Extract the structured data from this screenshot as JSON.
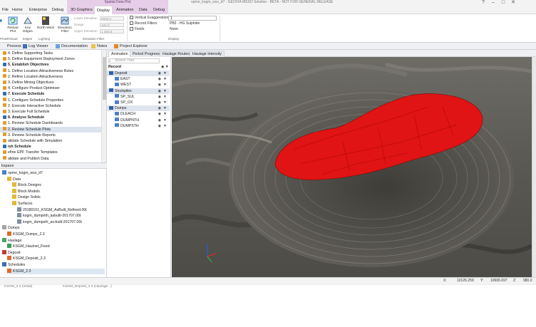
{
  "window": {
    "title": "opme_kogm_wsx_d7 - GEOVIA MSSO Solution - BETA - NOT FOR GENERAL RELEASE",
    "context_group": "Spatial Data Plot"
  },
  "ribbon_tabs": [
    "File",
    "Home",
    "Enterprise",
    "Debug",
    "3D Graphics",
    "Display",
    "Animation",
    "Data",
    "Debug"
  ],
  "ribbon_tab_active": "Display",
  "ribbon": {
    "reload_label": "Reload Plot",
    "key_edges_label": "Key Edges",
    "north_west_label": "North-West",
    "elevation_filter_label": "Elevation Filter",
    "fields": [
      {
        "label": "Lower Elevation",
        "value": "0003.0"
      },
      {
        "label": "Range",
        "value": "100.0"
      },
      {
        "label": "Upper Elevation",
        "value": "1 400.0"
      }
    ],
    "groups": [
      "Plots",
      "Reload",
      "Edges",
      "Lighting",
      "Elevation Filter"
    ],
    "vertical_exaggeration_label": "Vertical Exaggeration",
    "vertical_exaggeration_value": "1",
    "record_filters_label": "Record Filters",
    "record_filters_value": "PB2 - HG Sulphide",
    "fields_label": "Fields",
    "fields_value": "None",
    "display_group": "Display"
  },
  "doc_tabs": [
    "Process",
    "Log Viewer",
    "Documentation",
    "Notes",
    "Project Explorer"
  ],
  "process_items": [
    {
      "text": "4. Define Supporting Tasks",
      "kind": "item"
    },
    {
      "text": "5. Define Equipment Deployment Zones",
      "kind": "item"
    },
    {
      "text": "5. Establish Objectives",
      "kind": "head"
    },
    {
      "text": "1. Define Location Attractiveness Rules",
      "kind": "item"
    },
    {
      "text": "2. Refine Location Attractiveness",
      "kind": "item"
    },
    {
      "text": "3. Define Mining Objectives",
      "kind": "item"
    },
    {
      "text": "4. Configure Product Optimiser",
      "kind": "item"
    },
    {
      "text": "7. Execute Schedule",
      "kind": "head"
    },
    {
      "text": "1. Configure Schedule Properties",
      "kind": "item"
    },
    {
      "text": "2. Execute Interactive Schedule",
      "kind": "item"
    },
    {
      "text": "3. Execute Full Schedule",
      "kind": "item"
    },
    {
      "text": "8. Analyse Schedule",
      "kind": "head"
    },
    {
      "text": "1. Review Schedule Dashboards",
      "kind": "item"
    },
    {
      "text": "2. Review Schedule Plots",
      "kind": "sel"
    },
    {
      "text": "3. Review Schedule Reports",
      "kind": "item"
    },
    {
      "text": "alidate Schedule with Simulation",
      "kind": "item"
    },
    {
      "text": "ish Schedule",
      "kind": "head"
    },
    {
      "text": "efine EPF Transfer Templates",
      "kind": "item"
    },
    {
      "text": "alidate and Publish Data",
      "kind": "item"
    }
  ],
  "workspace": {
    "header": "kspace",
    "items": [
      {
        "text": "opme_kogm_wsx_d7",
        "indent": 0,
        "icon": "project",
        "sel": false
      },
      {
        "text": "Data",
        "indent": 1,
        "icon": "folder",
        "sel": false
      },
      {
        "text": "Block Designs",
        "indent": 2,
        "icon": "folder",
        "sel": false
      },
      {
        "text": "Block Models",
        "indent": 2,
        "icon": "folder",
        "sel": false
      },
      {
        "text": "Design Solids",
        "indent": 2,
        "icon": "folder",
        "sel": false
      },
      {
        "text": "Surfaces",
        "indent": 2,
        "icon": "folder",
        "sel": false
      },
      {
        "text": "20180101_KSGM_AsBuilt_Refined.00t",
        "indent": 3,
        "icon": "surface",
        "sel": false
      },
      {
        "text": "kogm_dumpnth_asbuilt-201707.00t",
        "indent": 3,
        "icon": "surface",
        "sel": false
      },
      {
        "text": "kogm_dumpsth_as-built-201707.00t",
        "indent": 3,
        "icon": "surface",
        "sel": false
      },
      {
        "text": "Dumps",
        "indent": 0,
        "icon": "dump",
        "sel": false
      },
      {
        "text": "KSGM_Dumps_2.3",
        "indent": 1,
        "icon": "edit",
        "sel": false
      },
      {
        "text": "Haulage",
        "indent": 0,
        "icon": "haulage",
        "sel": false
      },
      {
        "text": "KSGM_Haulnet_Fixed",
        "indent": 1,
        "icon": "haulnet",
        "sel": false
      },
      {
        "text": "Deposit",
        "indent": 0,
        "icon": "deposit",
        "sel": false
      },
      {
        "text": "KSGM_Deposit_2.3",
        "indent": 1,
        "icon": "edit",
        "sel": false
      },
      {
        "text": "Schedules",
        "indent": 0,
        "icon": "schedule",
        "sel": false
      },
      {
        "text": "KSGM_2.3",
        "indent": 1,
        "icon": "edit",
        "sel": true
      }
    ]
  },
  "viewer_tabs": [
    "Animation",
    "Period Progress",
    "Haulage Routes",
    "Haulage Intensity"
  ],
  "viewer_tab_active": "Animation",
  "scene_tree": {
    "search_placeholder": "Search Tree",
    "header": "Record",
    "rows": [
      {
        "text": "Deposit",
        "level": 0,
        "group": true
      },
      {
        "text": "EAST",
        "level": 1,
        "group": false
      },
      {
        "text": "WEST",
        "level": 1,
        "group": false
      },
      {
        "text": "Stockpiles",
        "level": 0,
        "group": true
      },
      {
        "text": "SP_SUL",
        "level": 1,
        "group": false
      },
      {
        "text": "SP_OX",
        "level": 1,
        "group": false
      },
      {
        "text": "Dumps",
        "level": 0,
        "group": true
      },
      {
        "text": "DLEACH",
        "level": 1,
        "group": false
      },
      {
        "text": "DUMPNTH",
        "level": 1,
        "group": false
      },
      {
        "text": "DUMPSTH",
        "level": 1,
        "group": false
      }
    ]
  },
  "statusbar": {
    "x_label": "X:",
    "x_value": "10126.259",
    "y_label": "Y:",
    "y_value": "10665.697",
    "z_label": "Z:",
    "z_value": "980.0"
  },
  "underbar": [
    "KSGM_2.3 (Initial)",
    "KSGM_Deposit_2.3 (Haulage...)"
  ],
  "colors": {
    "accent_purple": "#e6cde8",
    "deposit_red": "#e01414",
    "selection": "#dbe3ef",
    "terrain": "#5b5a54"
  }
}
